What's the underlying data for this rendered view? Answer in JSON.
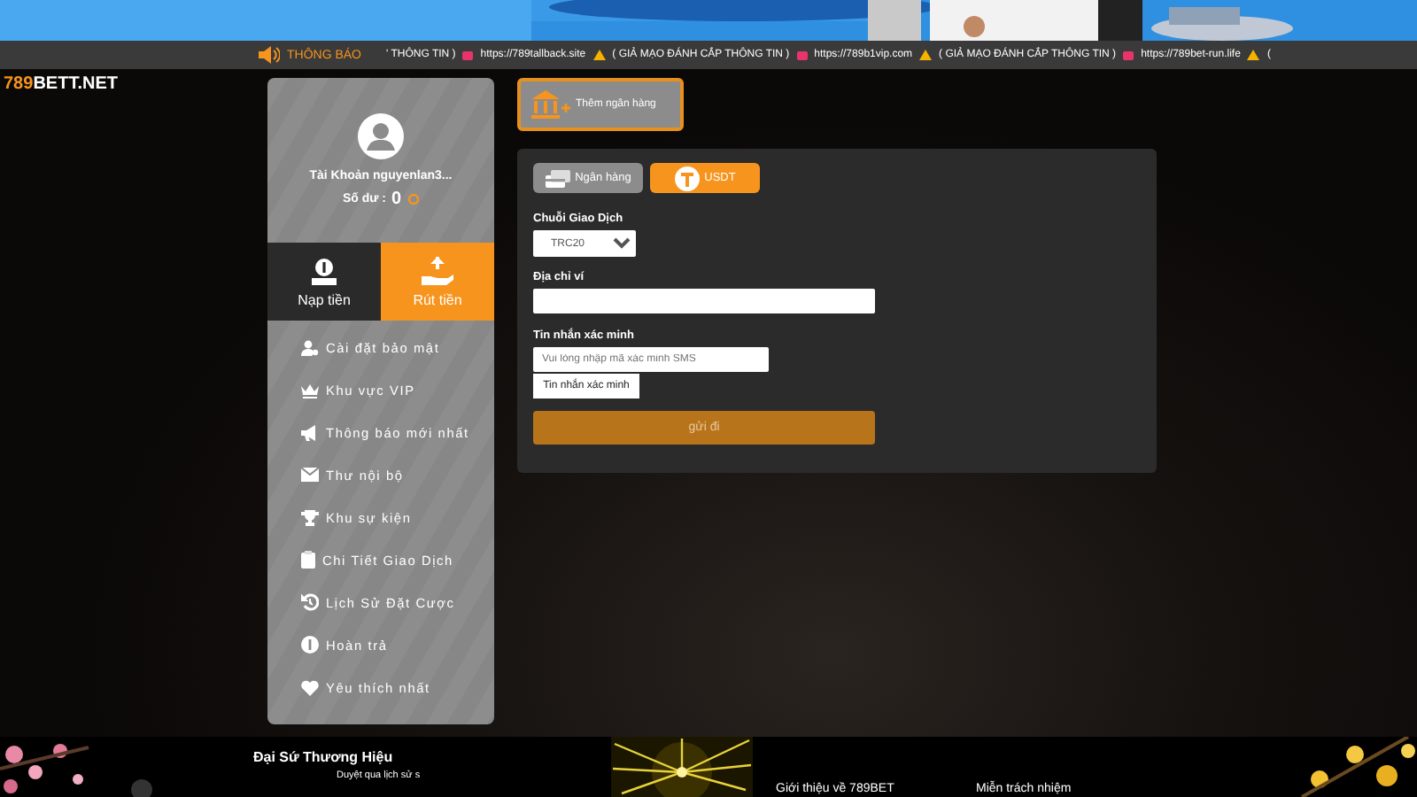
{
  "ticker": {
    "label": "THÔNG BÁO",
    "items": [
      {
        "kind": "text",
        "text": "' THÔNG TIN )"
      },
      {
        "kind": "link",
        "text": "https://789tallback.site"
      },
      {
        "kind": "warning",
        "text": "( GIẢ MẠO ĐÁNH CẮP THÔNG TIN )"
      },
      {
        "kind": "link",
        "text": "https://789b1vip.com"
      },
      {
        "kind": "warning",
        "text": "( GIẢ MẠO ĐÁNH CẮP THÔNG TIN )"
      },
      {
        "kind": "link",
        "text": "https://789bet-run.life"
      },
      {
        "kind": "warning",
        "text": "( "
      }
    ]
  },
  "logo": {
    "prefix": "789",
    "suffix": "BETT.NET"
  },
  "account": {
    "name": "Tài Khoản nguyenlan3...",
    "balance_label": "Số dư :",
    "balance": "0"
  },
  "actions": [
    {
      "kind": "deposit",
      "label": "Nạp tiền",
      "selected": false
    },
    {
      "kind": "withdraw",
      "label": "Rút tiền",
      "selected": true
    }
  ],
  "menu": [
    {
      "kind": "security",
      "label": "Cài đặt bảo mật"
    },
    {
      "kind": "vip",
      "label": "Khu vực VIP"
    },
    {
      "kind": "announce",
      "label": "Thông báo mới nhất"
    },
    {
      "kind": "mail",
      "label": "Thư nội bộ"
    },
    {
      "kind": "event",
      "label": "Khu sự kiện"
    },
    {
      "kind": "transactions",
      "label": "Chi Tiết Giao Dịch"
    },
    {
      "kind": "history",
      "label": "Lịch Sử Đặt Cược"
    },
    {
      "kind": "refund",
      "label": "Hoàn trả"
    },
    {
      "kind": "favorite",
      "label": "Yêu thích nhất"
    }
  ],
  "add_bank": {
    "label": "Thêm ngân hàng"
  },
  "methods": [
    {
      "kind": "bank",
      "label": "Ngân hàng",
      "selected": false
    },
    {
      "kind": "usdt",
      "label": "USDT",
      "selected": true
    }
  ],
  "chain": {
    "label": "Chuỗi Giao Dịch",
    "value": "TRC20"
  },
  "wallet": {
    "label": "Địa chỉ ví"
  },
  "sms": {
    "label": "Tin nhắn xác minh",
    "placeholder": "Vui lòng nhập mã xác minh SMS",
    "button": "Tin nhắn xác minh"
  },
  "submit": {
    "label": "gửi đi",
    "disabled": true
  },
  "footer": {
    "ambassador": "Đại Sứ Thương Hiệu",
    "ambassador_note": "Duyệt qua lịch sử s",
    "links": [
      "Giới thiệu về 789BET",
      "Miễn trách nhiệm"
    ]
  }
}
